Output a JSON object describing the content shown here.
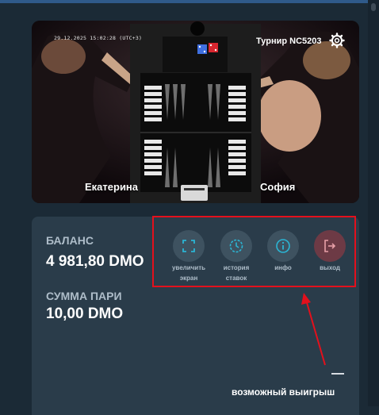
{
  "video": {
    "timestamp": "29.12.2025 15:02:28 (UTC+3)",
    "tournament": "Турнир NC5203",
    "player_left": "Екатерина",
    "player_right": "София"
  },
  "balance": {
    "label": "БАЛАНС",
    "value": "4 981,80 DMO"
  },
  "bet": {
    "label": "СУММА ПАРИ",
    "value": "10,00 DMO"
  },
  "controls": [
    {
      "label_line1": "увеличить",
      "label_line2": "экран",
      "icon": "fullscreen-icon"
    },
    {
      "label_line1": "история",
      "label_line2": "ставок",
      "icon": "history-icon"
    },
    {
      "label_line1": "инфо",
      "label_line2": "",
      "icon": "info-icon"
    },
    {
      "label_line1": "выход",
      "label_line2": "",
      "icon": "exit-icon"
    }
  ],
  "possible_win": {
    "label": "возможный выигрыш"
  },
  "colors": {
    "background": "#1b2a36",
    "panel": "#2a3c4a",
    "highlight": "#e3101c",
    "accent": "#2bb5d4"
  }
}
